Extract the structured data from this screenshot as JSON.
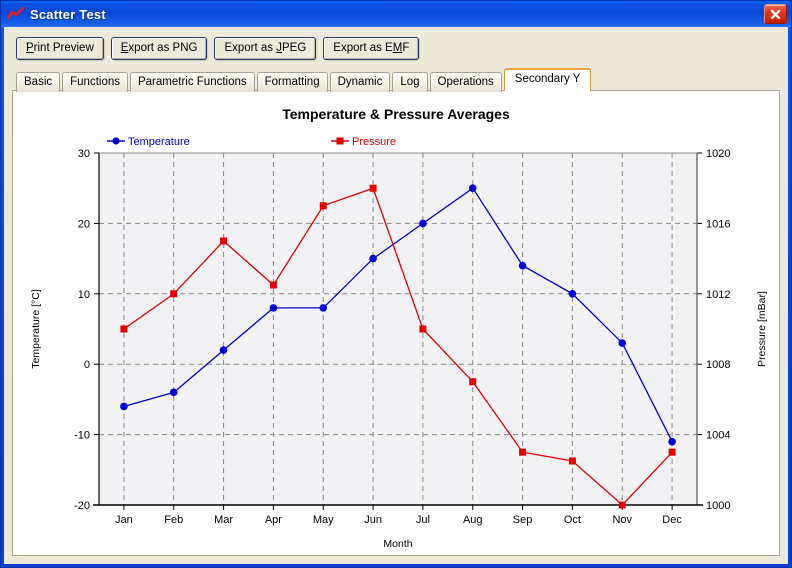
{
  "window": {
    "title": "Scatter Test",
    "icon": "line-chart-icon",
    "close_label": "Close",
    "titlebar_color": "#0a46d6",
    "client_color": "#ece9d8"
  },
  "toolbar": {
    "buttons": [
      {
        "label": "Print Preview",
        "mnemonic": "P",
        "name": "print-preview-button"
      },
      {
        "label": "Export as PNG",
        "mnemonic": "E",
        "name": "export-png-button"
      },
      {
        "label": "Export as JPEG",
        "mnemonic": "J",
        "name": "export-jpeg-button"
      },
      {
        "label": "Export as EMF",
        "mnemonic": "M",
        "name": "export-emf-button"
      }
    ]
  },
  "tabs": {
    "items": [
      {
        "label": "Basic",
        "active": false
      },
      {
        "label": "Functions",
        "active": false
      },
      {
        "label": "Parametric Functions",
        "active": false
      },
      {
        "label": "Formatting",
        "active": false
      },
      {
        "label": "Dynamic",
        "active": false
      },
      {
        "label": "Log",
        "active": false
      },
      {
        "label": "Operations",
        "active": false
      },
      {
        "label": "Secondary Y",
        "active": true
      }
    ],
    "active_index": 7
  },
  "chart_data": {
    "type": "line",
    "title": "Temperature & Pressure Averages",
    "xlabel": "Month",
    "ylabel": "Temperature [°C]",
    "y2label": "Pressure [mBar]",
    "categories": [
      "Jan",
      "Feb",
      "Mar",
      "Apr",
      "May",
      "Jun",
      "Jul",
      "Aug",
      "Sep",
      "Oct",
      "Nov",
      "Dec"
    ],
    "ylim": [
      -20,
      30
    ],
    "yticks": [
      30,
      20,
      10,
      0,
      -10,
      -20
    ],
    "y2lim": [
      1000,
      1020
    ],
    "y2ticks": [
      1020,
      1016,
      1012,
      1008,
      1004,
      1000
    ],
    "grid": true,
    "legend_position": "top",
    "plot_background": "#f2f2f5",
    "series": [
      {
        "name": "Temperature",
        "axis": "left",
        "color": "#0000d0",
        "marker": "circle",
        "values": [
          -6,
          -4,
          2,
          8,
          8,
          15,
          20,
          25,
          14,
          10,
          3,
          -11
        ]
      },
      {
        "name": "Pressure",
        "axis": "right",
        "color": "#e00000",
        "marker": "square",
        "values": [
          1010,
          1012,
          1015,
          1012.5,
          1017,
          1018,
          1010,
          1007,
          1003,
          1002.5,
          1000,
          1003
        ]
      }
    ]
  }
}
